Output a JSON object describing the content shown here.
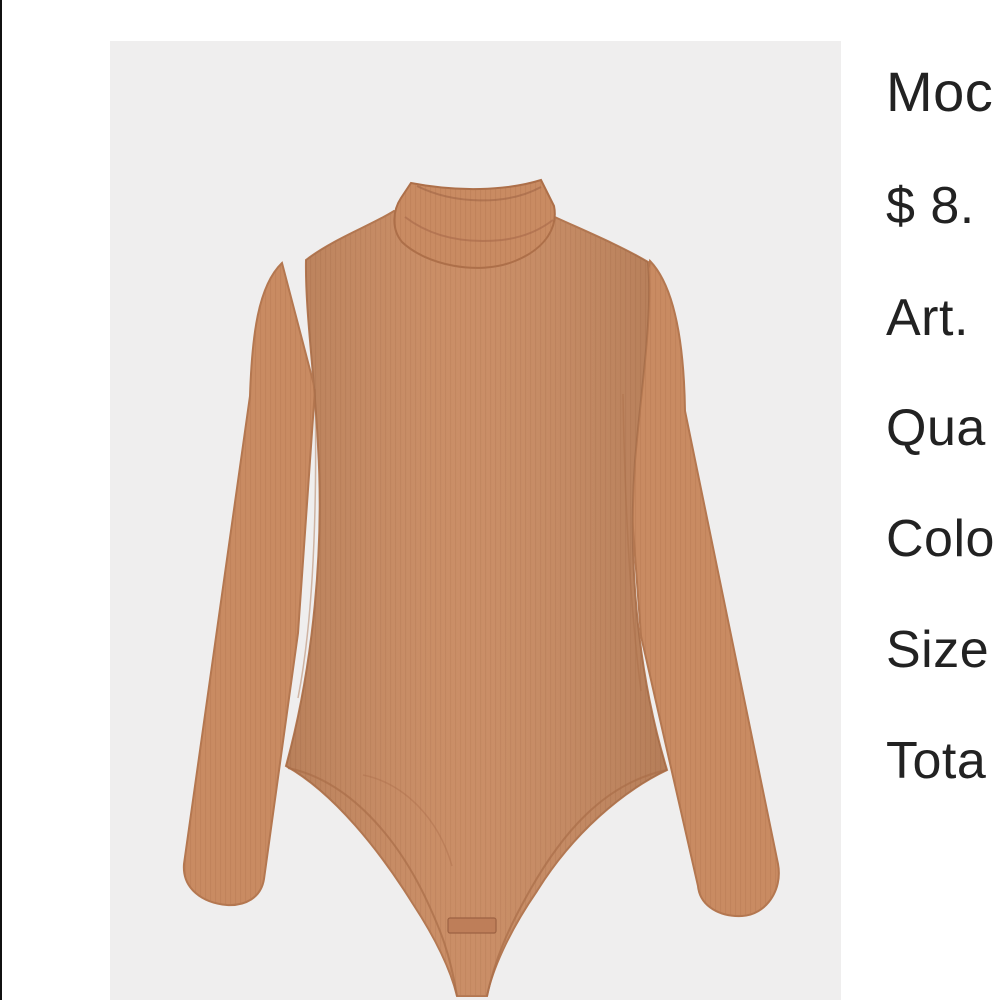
{
  "product": {
    "image_alt": "bodysuit-photo",
    "garment_color": "#c98b62",
    "background_color": "#efeeee",
    "name_visible": "Moc",
    "price_visible": "$ 8.",
    "details": {
      "article_label": "Art.",
      "quantity_label": "Qua",
      "color_label": "Colo",
      "size_label": "Size",
      "total_label": "Tota"
    }
  }
}
